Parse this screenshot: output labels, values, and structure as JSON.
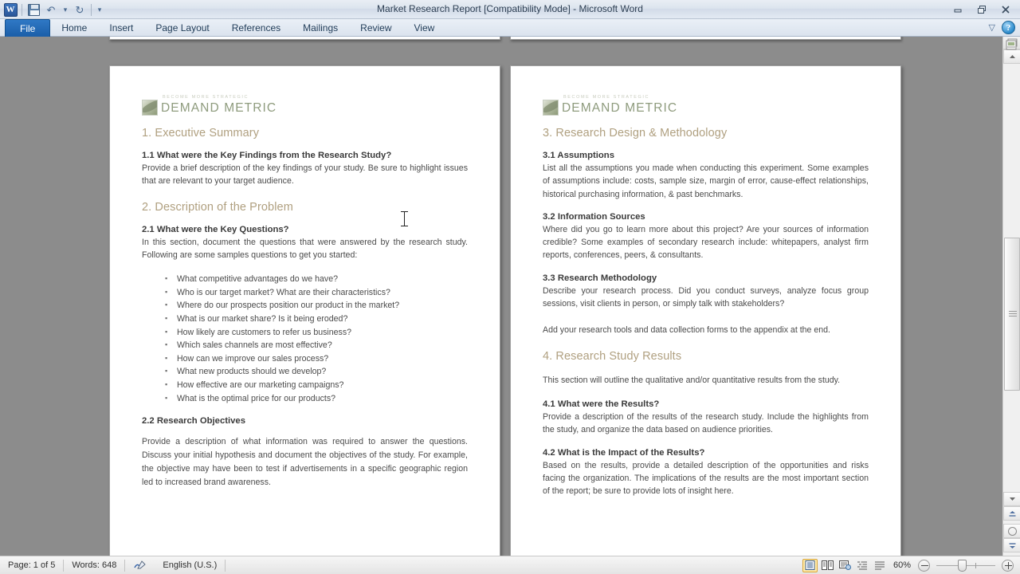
{
  "window": {
    "title": "Market Research Report [Compatibility Mode]  -  Microsoft Word",
    "app_badge": "W",
    "minimize_label": "Minimize",
    "restore_label": "Restore Down",
    "close_label": "Close"
  },
  "quick_access": {
    "save_label": "Save",
    "undo_label": "Undo",
    "redo_label": "Repeat",
    "customize_label": "Customize Quick Access Toolbar"
  },
  "ribbon": {
    "tabs": [
      {
        "label": "File",
        "active": true
      },
      {
        "label": "Home",
        "active": false
      },
      {
        "label": "Insert",
        "active": false
      },
      {
        "label": "Page Layout",
        "active": false
      },
      {
        "label": "References",
        "active": false
      },
      {
        "label": "Mailings",
        "active": false
      },
      {
        "label": "Review",
        "active": false
      },
      {
        "label": "View",
        "active": false
      }
    ],
    "minimize_ribbon_label": "Minimize the Ribbon",
    "help_label": "?"
  },
  "document": {
    "logo": {
      "tagline": "BECOME MORE STRATEGIC",
      "name_part1": "Demand",
      "name_part2": "Metric"
    },
    "left_page": {
      "heading_1": "1. Executive Summary",
      "sub_1_1": "1.1 What were the Key Findings from the Research  Study?",
      "body_1_1": "Provide a brief description of the key findings of your study.  Be sure to highlight issues that are relevant to your target audience.",
      "heading_2": "2. Description of the Problem",
      "sub_2_1": "2.1 What were the Key Questions?",
      "body_2_1": "In this section, document the questions that were answered by the research study.  Following are some samples questions to get you started:",
      "bullets": [
        "What competitive advantages do we have?",
        "Who is our target market?  What are their characteristics?",
        "Where do our prospects position our product in the market?",
        "What is our market share?  Is it being eroded?",
        "How likely are customers to refer us business?",
        "Which sales channels are most effective?",
        "How can we improve our sales process?",
        "What new products should we develop?",
        "How effective are our marketing campaigns?",
        "What is the optimal price for our products?"
      ],
      "sub_2_2": "2.2 Research  Objectives",
      "body_2_2": "Provide a description of what information was required to answer the questions.  Discuss your initial hypothesis and document the objectives of the study.  For example, the objective may have been to test if advertisements in a specific geographic region led to increased brand awareness."
    },
    "right_page": {
      "heading_3": "3. Research Design & Methodology",
      "sub_3_1": "3.1 Assumptions",
      "body_3_1": "List all the assumptions you made when conducting this experiment.  Some examples of assumptions include: costs, sample size, margin of error, cause-effect relationships, historical purchasing information, & past benchmarks.",
      "sub_3_2": "3.2 Information Sources",
      "body_3_2": "Where did you go to learn more about this project?  Are your sources of information credible? Some examples of secondary research include: whitepapers, analyst firm reports, conferences, peers, & consultants.",
      "sub_3_3": "3.3 Research  Methodology",
      "body_3_3": "Describe your research process.  Did you conduct surveys, analyze focus group sessions, visit clients in person, or simply talk with stakeholders?",
      "body_3_4": "Add your research tools and data collection forms to the appendix at the end.",
      "heading_4": "4. Research Study Results",
      "body_4_intro": "This section will outline the qualitative and/or quantitative results from the study.",
      "sub_4_1": "4.1 What were the Results?",
      "body_4_1": "Provide a description of the results of the research study.  Include the highlights from the study, and organize the data based on audience priorities.",
      "sub_4_2": "4.2 What is the Impact of the Results?",
      "body_4_2": "Based on the results, provide a detailed description of the opportunities and risks facing the organization.  The implications of the results are the most important section of the report; be sure to provide lots of insight here."
    }
  },
  "status_bar": {
    "page": "Page: 1 of 5",
    "words": "Words: 648",
    "language": "English (U.S.)",
    "proofing_label": "Proofing errors",
    "zoom_level": "60%",
    "zoom_out_label": "Zoom Out",
    "zoom_in_label": "Zoom In",
    "view_buttons": [
      {
        "name": "print-layout",
        "active": true
      },
      {
        "name": "full-screen-reading",
        "active": false
      },
      {
        "name": "web-layout",
        "active": false
      },
      {
        "name": "outline",
        "active": false
      },
      {
        "name": "draft",
        "active": false
      }
    ]
  },
  "scrollbar": {
    "split_label": "Split",
    "up_label": "Line Up",
    "down_label": "Line Down",
    "previous_page_label": "Previous Page",
    "select_browse_object_label": "Select Browse Object",
    "next_page_label": "Next Page"
  },
  "colors": {
    "heading": "#b0a080",
    "logo_green": "#8e9b7d",
    "accent_blue": "#1b5ea8",
    "zoom_active": "#ffe9a8"
  }
}
